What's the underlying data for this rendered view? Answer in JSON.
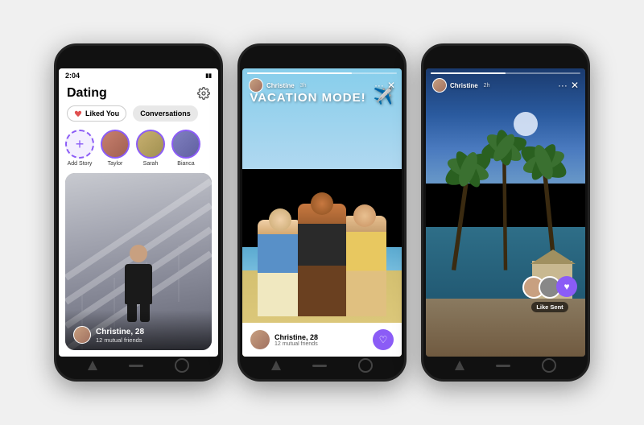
{
  "phone1": {
    "status_time": "2:04",
    "title": "Dating",
    "tab_liked": "Liked You",
    "tab_conversations": "Conversations",
    "stories": [
      {
        "label": "Add Story",
        "type": "add"
      },
      {
        "label": "Taylor",
        "type": "avatar",
        "color": "taylor"
      },
      {
        "label": "Sarah",
        "type": "avatar",
        "color": "sarah"
      },
      {
        "label": "Bianca",
        "type": "avatar",
        "color": "bianca"
      }
    ],
    "profile": {
      "name": "Christine, 28",
      "mutual": "12 mutual friends"
    }
  },
  "phone2": {
    "user_name": "Christine",
    "time_ago": "3h",
    "vacation_text": "VACATION MODE!",
    "profile": {
      "name": "Christine, 28",
      "mutual": "12 mutual friends"
    },
    "dots": "···",
    "close": "✕"
  },
  "phone3": {
    "user_name": "Christine",
    "time_ago": "2h",
    "like_sent_label": "Like Sent",
    "dots": "···",
    "close": "✕"
  }
}
